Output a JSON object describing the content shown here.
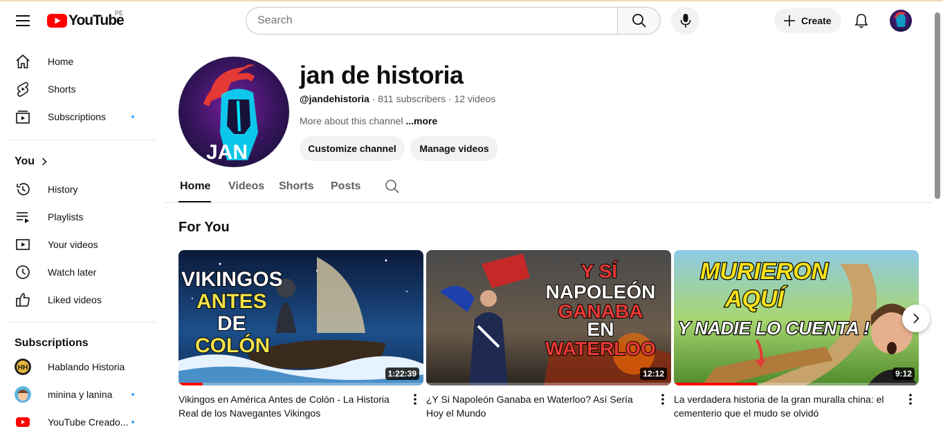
{
  "header": {
    "logo_text": "YouTube",
    "country_code": "PE",
    "search_placeholder": "Search",
    "create_label": "Create"
  },
  "sidebar": {
    "main": [
      {
        "label": "Home",
        "icon": "home-icon"
      },
      {
        "label": "Shorts",
        "icon": "shorts-icon"
      },
      {
        "label": "Subscriptions",
        "icon": "subscriptions-icon",
        "dot": true
      }
    ],
    "you_title": "You",
    "you": [
      {
        "label": "History",
        "icon": "history-icon"
      },
      {
        "label": "Playlists",
        "icon": "playlists-icon"
      },
      {
        "label": "Your videos",
        "icon": "your-videos-icon"
      },
      {
        "label": "Watch later",
        "icon": "watch-later-icon"
      },
      {
        "label": "Liked videos",
        "icon": "liked-videos-icon"
      }
    ],
    "subscriptions_title": "Subscriptions",
    "subscriptions": [
      {
        "label": "Hablando Historia",
        "dot": false
      },
      {
        "label": "minina y lanina",
        "dot": true
      },
      {
        "label": "YouTube Creado...",
        "dot": true
      }
    ]
  },
  "channel": {
    "name": "jan de historia",
    "handle": "@jandehistoria",
    "subscribers": "811 subscribers",
    "videos": "12 videos",
    "more_text": "More about this channel",
    "more_link": "...more",
    "customize_label": "Customize channel",
    "manage_label": "Manage videos",
    "avatar_text": "JAN"
  },
  "tabs": [
    "Home",
    "Videos",
    "Shorts",
    "Posts"
  ],
  "section_title": "For You",
  "videos": [
    {
      "title": "Vikingos en América Antes de Colón - La Historia Real de los Navegantes Vikingos",
      "duration": "1:22:39",
      "progress": 0.1,
      "thumb_lines": [
        "VIKINGOS",
        "ANTES",
        "DE",
        "COLÓN"
      ]
    },
    {
      "title": "¿Y Si Napoleón Ganaba en Waterloo? Así Sería Hoy el Mundo",
      "duration": "12:12",
      "progress": 0.0,
      "thumb_lines": [
        "Y SÍ",
        "NAPOLEÓN",
        "GANABA",
        "EN",
        "WATERLOO"
      ]
    },
    {
      "title": "La verdadera historia de la gran muralla china: el cementerio que el mudo se olvidó",
      "duration": "9:12",
      "progress": 0.34,
      "thumb_lines": [
        "MURIERON",
        "AQUÍ",
        "Y NADIE LO CUENTA !"
      ]
    }
  ],
  "colors": {
    "brand_red": "#ff0000",
    "text_primary": "#0f0f0f",
    "text_secondary": "#606060",
    "accent_dot": "#3ea6ff"
  }
}
